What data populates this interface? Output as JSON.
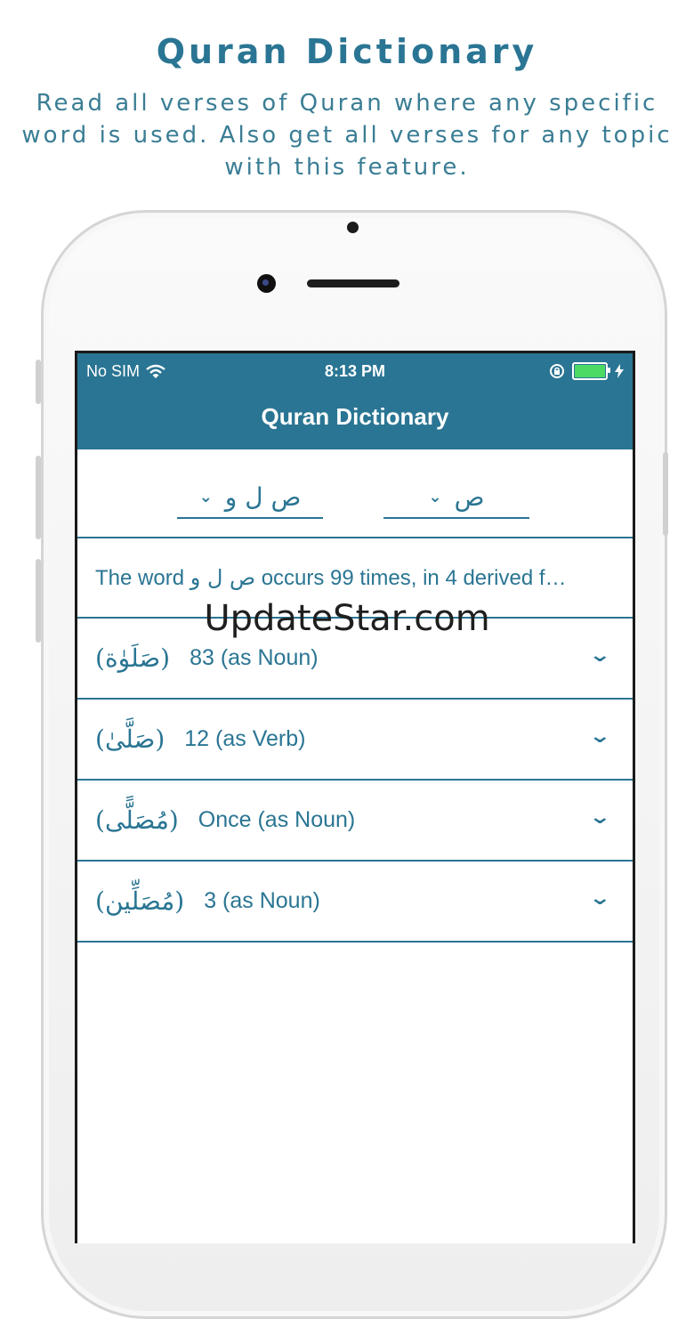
{
  "promo": {
    "title": "Quran Dictionary",
    "subtitle": "Read all verses of Quran where any specific word is used. Also get all verses for any topic with this feature."
  },
  "status_bar": {
    "carrier": "No SIM",
    "time": "8:13 PM",
    "icons": [
      "wifi-icon",
      "orientation-lock-icon",
      "battery-icon",
      "charging-icon"
    ]
  },
  "app": {
    "title": "Quran Dictionary",
    "color_accent": "#2a7593"
  },
  "selectors": {
    "root": "ص ل و",
    "letter": "ص"
  },
  "summary": {
    "prefix": "The word ",
    "root": "ص ل و",
    "suffix": " occurs 99 times, in 4 derived f…"
  },
  "forms": [
    {
      "arabic": "(صَلَوٰة)",
      "count": "83 (as Noun)"
    },
    {
      "arabic": "(صَلَّىٰ)",
      "count": "12 (as Verb)"
    },
    {
      "arabic": "(مُصَلًّى)",
      "count": "Once (as Noun)"
    },
    {
      "arabic": "(مُصَلِّين)",
      "count": "3 (as Noun)"
    }
  ],
  "watermark": "UpdateStar.com"
}
